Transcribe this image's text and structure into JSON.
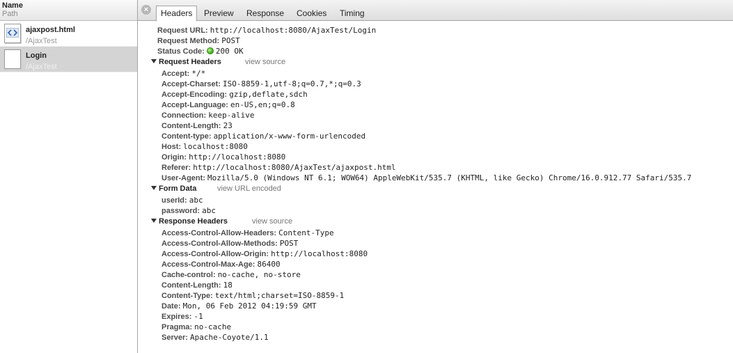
{
  "left": {
    "header_name": "Name",
    "header_path": "Path",
    "requests": [
      {
        "name": "ajaxpost.html",
        "path": "/AjaxTest",
        "icon": "html-file-icon",
        "selected": false
      },
      {
        "name": "Login",
        "path": "/AjaxTest",
        "icon": "blank-file-icon",
        "selected": true
      }
    ]
  },
  "tabs": [
    "Headers",
    "Preview",
    "Response",
    "Cookies",
    "Timing"
  ],
  "active_tab": "Headers",
  "general": [
    {
      "key": "Request URL:",
      "value": "http://localhost:8080/AjaxTest/Login"
    },
    {
      "key": "Request Method:",
      "value": "POST"
    },
    {
      "key": "Status Code:",
      "value": "200 OK",
      "status_color": "#3aa51a"
    }
  ],
  "request_headers": {
    "title": "Request Headers",
    "link": "view source",
    "items": [
      {
        "key": "Accept:",
        "value": "*/*"
      },
      {
        "key": "Accept-Charset:",
        "value": "ISO-8859-1,utf-8;q=0.7,*;q=0.3"
      },
      {
        "key": "Accept-Encoding:",
        "value": "gzip,deflate,sdch"
      },
      {
        "key": "Accept-Language:",
        "value": "en-US,en;q=0.8"
      },
      {
        "key": "Connection:",
        "value": "keep-alive"
      },
      {
        "key": "Content-Length:",
        "value": "23"
      },
      {
        "key": "Content-type:",
        "value": "application/x-www-form-urlencoded"
      },
      {
        "key": "Host:",
        "value": "localhost:8080"
      },
      {
        "key": "Origin:",
        "value": "http://localhost:8080"
      },
      {
        "key": "Referer:",
        "value": "http://localhost:8080/AjaxTest/ajaxpost.html"
      },
      {
        "key": "User-Agent:",
        "value": "Mozilla/5.0 (Windows NT 6.1; WOW64) AppleWebKit/535.7 (KHTML, like Gecko) Chrome/16.0.912.77 Safari/535.7"
      }
    ]
  },
  "form_data": {
    "title": "Form Data",
    "link": "view URL encoded",
    "items": [
      {
        "key": "userId:",
        "value": "abc"
      },
      {
        "key": "password:",
        "value": "abc"
      }
    ]
  },
  "response_headers": {
    "title": "Response Headers",
    "link": "view source",
    "items": [
      {
        "key": "Access-Control-Allow-Headers:",
        "value": "Content-Type"
      },
      {
        "key": "Access-Control-Allow-Methods:",
        "value": "POST"
      },
      {
        "key": "Access-Control-Allow-Origin:",
        "value": "http://localhost:8080"
      },
      {
        "key": "Access-Control-Max-Age:",
        "value": "86400"
      },
      {
        "key": "Cache-control:",
        "value": "no-cache, no-store"
      },
      {
        "key": "Content-Length:",
        "value": "18"
      },
      {
        "key": "Content-Type:",
        "value": "text/html;charset=ISO-8859-1"
      },
      {
        "key": "Date:",
        "value": "Mon, 06 Feb 2012 04:19:59 GMT"
      },
      {
        "key": "Expires:",
        "value": "-1"
      },
      {
        "key": "Pragma:",
        "value": "no-cache"
      },
      {
        "key": "Server:",
        "value": "Apache-Coyote/1.1"
      }
    ]
  }
}
